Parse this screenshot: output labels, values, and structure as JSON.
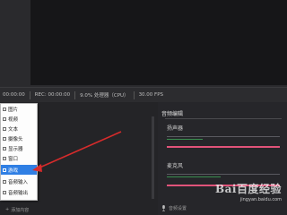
{
  "status_bar": {
    "time": "00:00:00",
    "rec": "REC: 00:00:00",
    "cpu": "9.0% 处理器（CPU）",
    "fps": "30.00 FPS"
  },
  "context_menu": {
    "items": [
      {
        "label": "图片",
        "icon": "image-icon"
      },
      {
        "label": "视频",
        "icon": "video-icon"
      },
      {
        "label": "文本",
        "icon": "text-icon"
      },
      {
        "label": "摄像头",
        "icon": "camera-icon"
      },
      {
        "label": "显示器",
        "icon": "monitor-icon"
      },
      {
        "label": "窗口",
        "icon": "window-icon"
      },
      {
        "label": "游戏",
        "icon": "game-icon",
        "selected": true
      },
      {
        "label": "音频输入",
        "icon": "audio-input-icon"
      },
      {
        "label": "音频输出",
        "icon": "audio-output-icon"
      }
    ]
  },
  "sources_panel": {
    "add_label": "添加内容"
  },
  "mixer": {
    "title": "音频编辑",
    "channels": [
      {
        "label": "扬声器"
      },
      {
        "label": "麦克风"
      }
    ],
    "settings_label": "音频设置"
  },
  "watermark": {
    "logo": "Bai百度经验",
    "url": "jingyan.baidu.com"
  },
  "colors": {
    "accent": "#2f7fe4",
    "meter": "#e1537a",
    "arrow": "#d62b2b"
  }
}
